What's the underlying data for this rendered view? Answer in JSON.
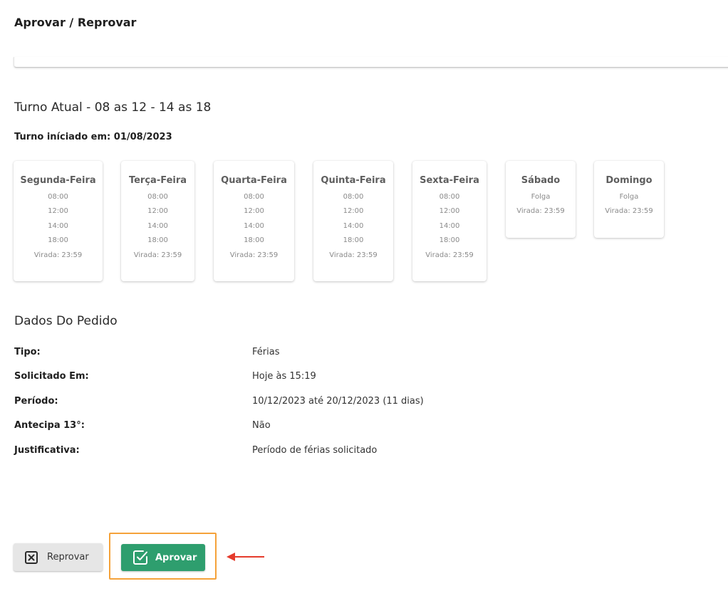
{
  "header": {
    "title": "Aprovar / Reprovar"
  },
  "shift": {
    "title": "Turno Atual - 08 as 12 - 14 as 18",
    "started": "Turno iníciado em: 01/08/2023",
    "days": [
      {
        "name": "Segunda-Feira",
        "lines": [
          "08:00",
          "12:00",
          "14:00",
          "18:00",
          "Virada: 23:59"
        ]
      },
      {
        "name": "Terça-Feira",
        "lines": [
          "08:00",
          "12:00",
          "14:00",
          "18:00",
          "Virada: 23:59"
        ]
      },
      {
        "name": "Quarta-Feira",
        "lines": [
          "08:00",
          "12:00",
          "14:00",
          "18:00",
          "Virada: 23:59"
        ]
      },
      {
        "name": "Quinta-Feira",
        "lines": [
          "08:00",
          "12:00",
          "14:00",
          "18:00",
          "Virada: 23:59"
        ]
      },
      {
        "name": "Sexta-Feira",
        "lines": [
          "08:00",
          "12:00",
          "14:00",
          "18:00",
          "Virada: 23:59"
        ]
      },
      {
        "name": "Sábado",
        "lines": [
          "Folga",
          "Virada: 23:59"
        ]
      },
      {
        "name": "Domingo",
        "lines": [
          "Folga",
          "Virada: 23:59"
        ]
      }
    ]
  },
  "request": {
    "title": "Dados Do Pedido",
    "fields": [
      {
        "label": "Tipo:",
        "value": "Férias"
      },
      {
        "label": "Solicitado Em:",
        "value": "Hoje às 15:19"
      },
      {
        "label": "Período:",
        "value": "10/12/2023 até 20/12/2023 (11 dias)"
      },
      {
        "label": "Antecipa 13°:",
        "value": "Não"
      },
      {
        "label": "Justificativa:",
        "value": "Período de férias solicitado"
      }
    ]
  },
  "actions": {
    "reject_label": "Reprovar",
    "reject_icon": "close-box-icon",
    "approve_label": "Aprovar",
    "approve_icon": "check-box-icon",
    "approve_color": "#2e9e6e",
    "highlight_color": "#f5a23a",
    "arrow_color": "#e53b2c"
  }
}
